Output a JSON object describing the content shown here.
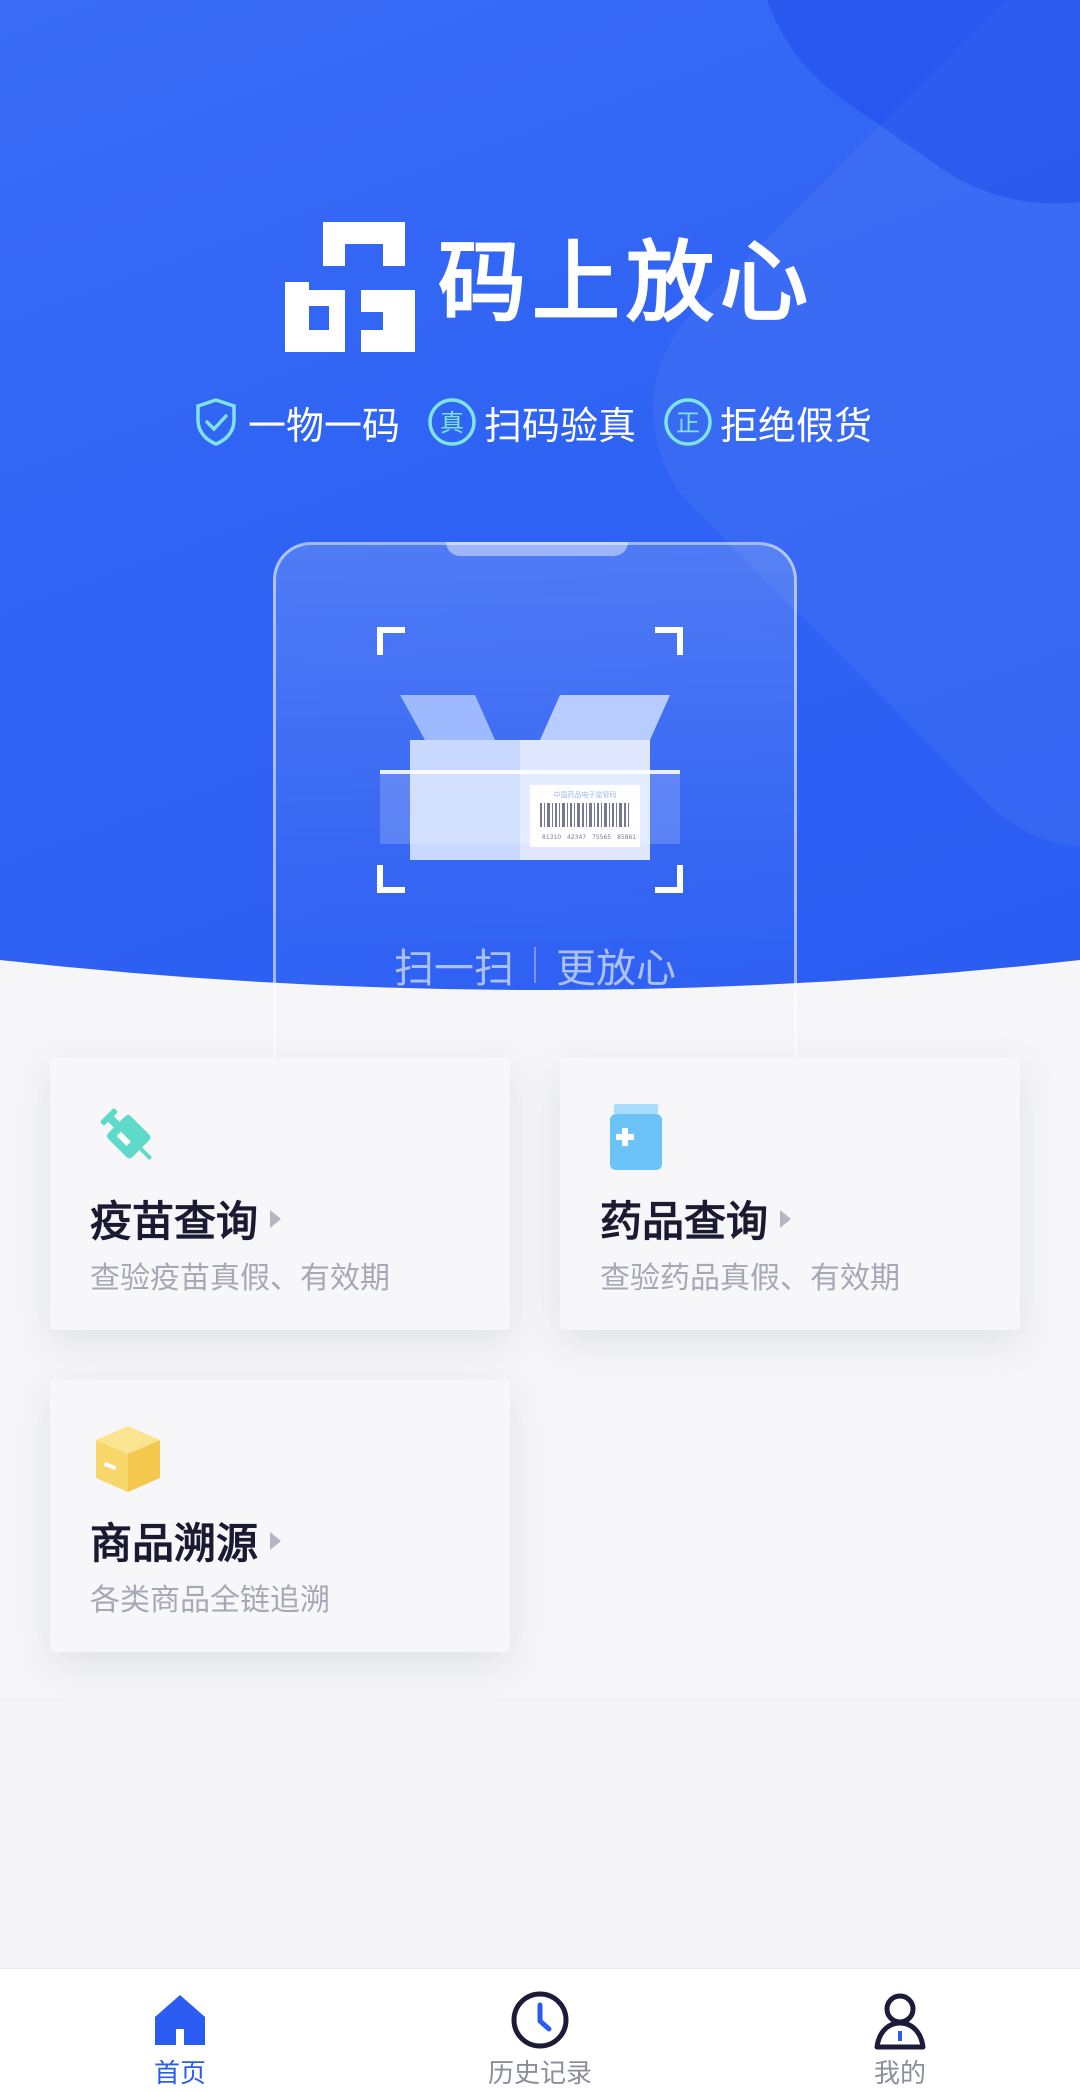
{
  "app": {
    "title": "码上放心",
    "slogans": [
      {
        "icon": "shield-check-icon",
        "text": "一物一码"
      },
      {
        "icon": "zhen-badge-icon",
        "badge": "真",
        "text": "扫码验真"
      },
      {
        "icon": "zheng-badge-icon",
        "badge": "正",
        "text": "拒绝假货"
      }
    ]
  },
  "scan": {
    "caption_left": "扫一扫",
    "caption_right": "更放心",
    "label_title": "中国药品电子监管码",
    "barcode_digits": [
      "81310",
      "42347",
      "75565",
      "85861"
    ]
  },
  "cards": [
    {
      "title": "疫苗查询",
      "desc": "查验疫苗真假、有效期",
      "icon": "vaccine-syringe-icon",
      "color": "#5fd9c9"
    },
    {
      "title": "药品查询",
      "desc": "查验药品真假、有效期",
      "icon": "medicine-bottle-icon",
      "color": "#6cc3f7"
    },
    {
      "title": "商品溯源",
      "desc": "各类商品全链追溯",
      "icon": "package-box-icon",
      "color": "#f8d76a"
    }
  ],
  "tabbar": {
    "items": [
      {
        "label": "首页",
        "icon": "home-icon",
        "active": true
      },
      {
        "label": "历史记录",
        "icon": "clock-icon",
        "active": false
      },
      {
        "label": "我的",
        "icon": "user-icon",
        "active": false
      }
    ]
  },
  "colors": {
    "primary": "#2a5cf2",
    "title_text": "#1a1a33",
    "muted_text": "#a6a8b6",
    "tab_inactive": "#8c8e99"
  }
}
